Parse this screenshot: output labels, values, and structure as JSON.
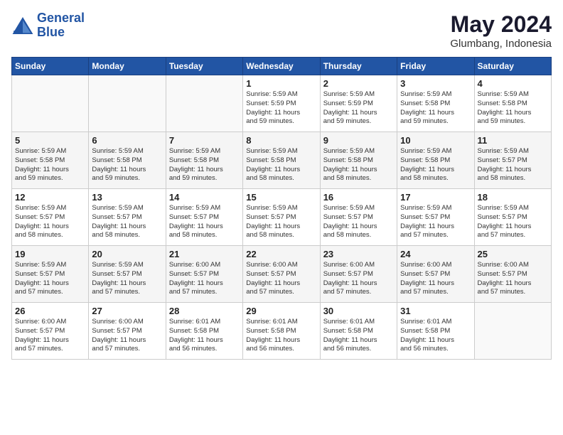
{
  "logo": {
    "line1": "General",
    "line2": "Blue"
  },
  "title": "May 2024",
  "subtitle": "Glumbang, Indonesia",
  "days_of_week": [
    "Sunday",
    "Monday",
    "Tuesday",
    "Wednesday",
    "Thursday",
    "Friday",
    "Saturday"
  ],
  "weeks": [
    [
      {
        "day": "",
        "info": ""
      },
      {
        "day": "",
        "info": ""
      },
      {
        "day": "",
        "info": ""
      },
      {
        "day": "1",
        "info": "Sunrise: 5:59 AM\nSunset: 5:59 PM\nDaylight: 11 hours\nand 59 minutes."
      },
      {
        "day": "2",
        "info": "Sunrise: 5:59 AM\nSunset: 5:59 PM\nDaylight: 11 hours\nand 59 minutes."
      },
      {
        "day": "3",
        "info": "Sunrise: 5:59 AM\nSunset: 5:58 PM\nDaylight: 11 hours\nand 59 minutes."
      },
      {
        "day": "4",
        "info": "Sunrise: 5:59 AM\nSunset: 5:58 PM\nDaylight: 11 hours\nand 59 minutes."
      }
    ],
    [
      {
        "day": "5",
        "info": "Sunrise: 5:59 AM\nSunset: 5:58 PM\nDaylight: 11 hours\nand 59 minutes."
      },
      {
        "day": "6",
        "info": "Sunrise: 5:59 AM\nSunset: 5:58 PM\nDaylight: 11 hours\nand 59 minutes."
      },
      {
        "day": "7",
        "info": "Sunrise: 5:59 AM\nSunset: 5:58 PM\nDaylight: 11 hours\nand 59 minutes."
      },
      {
        "day": "8",
        "info": "Sunrise: 5:59 AM\nSunset: 5:58 PM\nDaylight: 11 hours\nand 58 minutes."
      },
      {
        "day": "9",
        "info": "Sunrise: 5:59 AM\nSunset: 5:58 PM\nDaylight: 11 hours\nand 58 minutes."
      },
      {
        "day": "10",
        "info": "Sunrise: 5:59 AM\nSunset: 5:58 PM\nDaylight: 11 hours\nand 58 minutes."
      },
      {
        "day": "11",
        "info": "Sunrise: 5:59 AM\nSunset: 5:57 PM\nDaylight: 11 hours\nand 58 minutes."
      }
    ],
    [
      {
        "day": "12",
        "info": "Sunrise: 5:59 AM\nSunset: 5:57 PM\nDaylight: 11 hours\nand 58 minutes."
      },
      {
        "day": "13",
        "info": "Sunrise: 5:59 AM\nSunset: 5:57 PM\nDaylight: 11 hours\nand 58 minutes."
      },
      {
        "day": "14",
        "info": "Sunrise: 5:59 AM\nSunset: 5:57 PM\nDaylight: 11 hours\nand 58 minutes."
      },
      {
        "day": "15",
        "info": "Sunrise: 5:59 AM\nSunset: 5:57 PM\nDaylight: 11 hours\nand 58 minutes."
      },
      {
        "day": "16",
        "info": "Sunrise: 5:59 AM\nSunset: 5:57 PM\nDaylight: 11 hours\nand 58 minutes."
      },
      {
        "day": "17",
        "info": "Sunrise: 5:59 AM\nSunset: 5:57 PM\nDaylight: 11 hours\nand 57 minutes."
      },
      {
        "day": "18",
        "info": "Sunrise: 5:59 AM\nSunset: 5:57 PM\nDaylight: 11 hours\nand 57 minutes."
      }
    ],
    [
      {
        "day": "19",
        "info": "Sunrise: 5:59 AM\nSunset: 5:57 PM\nDaylight: 11 hours\nand 57 minutes."
      },
      {
        "day": "20",
        "info": "Sunrise: 5:59 AM\nSunset: 5:57 PM\nDaylight: 11 hours\nand 57 minutes."
      },
      {
        "day": "21",
        "info": "Sunrise: 6:00 AM\nSunset: 5:57 PM\nDaylight: 11 hours\nand 57 minutes."
      },
      {
        "day": "22",
        "info": "Sunrise: 6:00 AM\nSunset: 5:57 PM\nDaylight: 11 hours\nand 57 minutes."
      },
      {
        "day": "23",
        "info": "Sunrise: 6:00 AM\nSunset: 5:57 PM\nDaylight: 11 hours\nand 57 minutes."
      },
      {
        "day": "24",
        "info": "Sunrise: 6:00 AM\nSunset: 5:57 PM\nDaylight: 11 hours\nand 57 minutes."
      },
      {
        "day": "25",
        "info": "Sunrise: 6:00 AM\nSunset: 5:57 PM\nDaylight: 11 hours\nand 57 minutes."
      }
    ],
    [
      {
        "day": "26",
        "info": "Sunrise: 6:00 AM\nSunset: 5:57 PM\nDaylight: 11 hours\nand 57 minutes."
      },
      {
        "day": "27",
        "info": "Sunrise: 6:00 AM\nSunset: 5:57 PM\nDaylight: 11 hours\nand 57 minutes."
      },
      {
        "day": "28",
        "info": "Sunrise: 6:01 AM\nSunset: 5:58 PM\nDaylight: 11 hours\nand 56 minutes."
      },
      {
        "day": "29",
        "info": "Sunrise: 6:01 AM\nSunset: 5:58 PM\nDaylight: 11 hours\nand 56 minutes."
      },
      {
        "day": "30",
        "info": "Sunrise: 6:01 AM\nSunset: 5:58 PM\nDaylight: 11 hours\nand 56 minutes."
      },
      {
        "day": "31",
        "info": "Sunrise: 6:01 AM\nSunset: 5:58 PM\nDaylight: 11 hours\nand 56 minutes."
      },
      {
        "day": "",
        "info": ""
      }
    ]
  ]
}
